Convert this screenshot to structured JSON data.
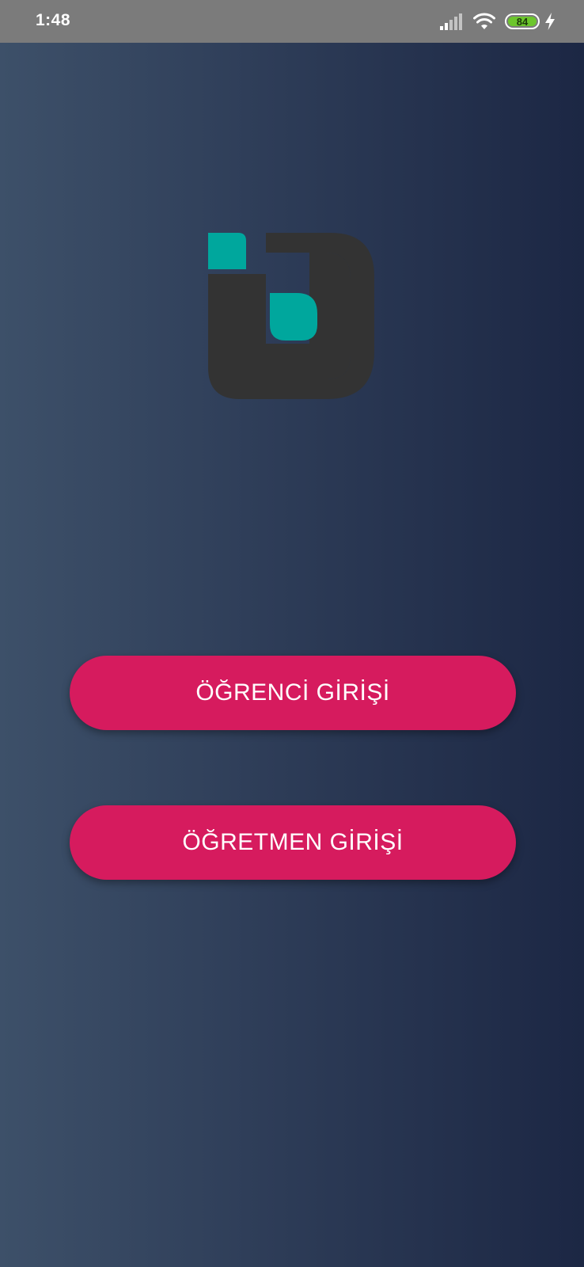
{
  "status_bar": {
    "time": "1:48",
    "battery_level": "84",
    "icons": [
      "signal-icon",
      "wifi-icon",
      "battery-icon",
      "charging-icon"
    ]
  },
  "logo": {
    "icon": "app-logo"
  },
  "buttons": {
    "student_login": "ÖĞRENCİ GİRİŞİ",
    "teacher_login": "ÖĞRETMEN GİRİŞİ"
  },
  "colors": {
    "background_start": "#3d5069",
    "background_end": "#1c2744",
    "button": "#d61b5e",
    "logo_accent": "#00a79d",
    "logo_dark": "#333333",
    "status_bar": "#7b7b7b"
  }
}
